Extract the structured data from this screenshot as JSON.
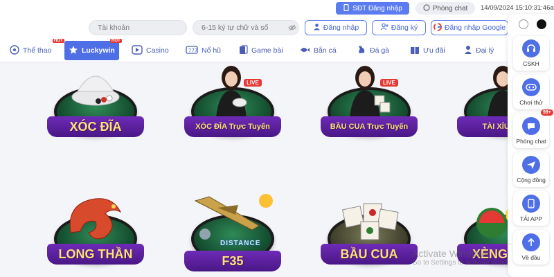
{
  "topbar": {
    "sdt_login": "SĐT Đăng nhập",
    "chat": "Phòng chat",
    "datetime": "14/09/2024 15:10:31:46am"
  },
  "login": {
    "account_placeholder": "Tài khoản",
    "password_placeholder": "6-15 ký tự chữ và số",
    "login_label": "Đăng nhập",
    "register_label": "Đăng ký",
    "google_label": "Đăng nhập Google"
  },
  "nav": {
    "items": [
      {
        "label": "Thể thao",
        "hot": "HOT"
      },
      {
        "label": "Luckywin",
        "hot": "HOT"
      },
      {
        "label": "Casino"
      },
      {
        "label": "Nổ hũ"
      },
      {
        "label": "Game bài"
      },
      {
        "label": "Bắn cá"
      },
      {
        "label": "Đá gà"
      },
      {
        "label": "Ưu đãi"
      },
      {
        "label": "Đại lý"
      }
    ]
  },
  "games": [
    {
      "title": "XÓC ĐĨA"
    },
    {
      "title": "XÓC ĐĨA Trực Tuyến",
      "live": "LIVE"
    },
    {
      "title": "BẦU CUA Trực Tuyến",
      "live": "LIVE"
    },
    {
      "title": "TÀI XỈU Trực"
    },
    {
      "title": "LONG THẦN"
    },
    {
      "title": "F35",
      "subtitle": "DISTANCE"
    },
    {
      "title": "BẦU CUA"
    },
    {
      "title": "XÈNG HOA"
    }
  ],
  "side": {
    "items": [
      {
        "label": "CSKH"
      },
      {
        "label": "Chơi thử"
      },
      {
        "label": "Phòng chat",
        "badge": "99+"
      },
      {
        "label": "Cộng đồng"
      },
      {
        "label": "TẢI APP"
      },
      {
        "label": "Về đầu"
      }
    ]
  },
  "watermark": {
    "line1": "Activate Windows",
    "line2": "Go to Settings to activate Windows."
  },
  "colors": {
    "accent": "#4f6fe6",
    "banner": "#5a1f9c",
    "banner_text": "#ffe07a",
    "hot": "#e53935"
  }
}
